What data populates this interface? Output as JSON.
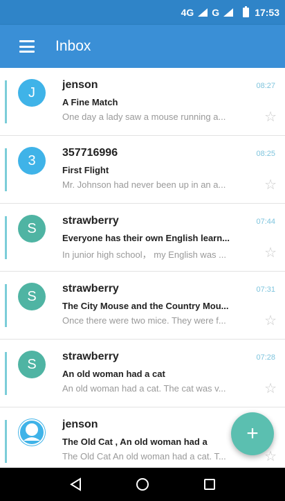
{
  "status_bar": {
    "network_label": "4G",
    "carrier2_label": "G",
    "time": "17:53",
    "icons": [
      "signal-icon",
      "signal-icon",
      "battery-icon"
    ]
  },
  "app_bar": {
    "title": "Inbox",
    "menu_icon": "menu-icon"
  },
  "colors": {
    "primary": "#3a8fd6",
    "status_bar": "#2f84c8",
    "avatar_blue": "#3fb3e8",
    "avatar_teal": "#4fb4a3",
    "accent": "#7bcdd8",
    "fab": "#5bbfb0"
  },
  "messages": [
    {
      "avatar_letter": "J",
      "avatar_color": "#3fb3e8",
      "sender": "jenson",
      "time": "08:27",
      "subject": "A Fine Match",
      "preview": "One day a lady saw a mouse running a...",
      "star_icon": "☆"
    },
    {
      "avatar_letter": "3",
      "avatar_color": "#3fb3e8",
      "sender": "357716996",
      "time": "08:25",
      "subject": "First Flight",
      "preview": "Mr. Johnson had never been up in an a...",
      "star_icon": "☆"
    },
    {
      "avatar_letter": "S",
      "avatar_color": "#4fb4a3",
      "sender": "strawberry",
      "time": "07:44",
      "subject": "Everyone has their own English learn...",
      "preview": "In junior high school， my English was ...",
      "star_icon": "☆"
    },
    {
      "avatar_letter": "S",
      "avatar_color": "#4fb4a3",
      "sender": "strawberry",
      "time": "07:31",
      "subject": "The City Mouse and the Country Mou...",
      "preview": "Once there were two mice. They were f...",
      "star_icon": "☆"
    },
    {
      "avatar_letter": "S",
      "avatar_color": "#4fb4a3",
      "sender": "strawberry",
      "time": "07:28",
      "subject": "An old woman had a cat",
      "preview": "An old woman had a cat. The cat was v...",
      "star_icon": "☆"
    },
    {
      "avatar_letter": "",
      "avatar_color": "#3fb3e8",
      "sender": "jenson",
      "time": "",
      "subject": "The Old Cat ,  An old woman had a",
      "preview": "The Old Cat An old woman had a cat. T...",
      "star_icon": "☆"
    }
  ],
  "fab": {
    "label": "+",
    "icon": "add-icon"
  },
  "nav_bar": {
    "back": "◁",
    "home": "○",
    "recents": "□"
  }
}
